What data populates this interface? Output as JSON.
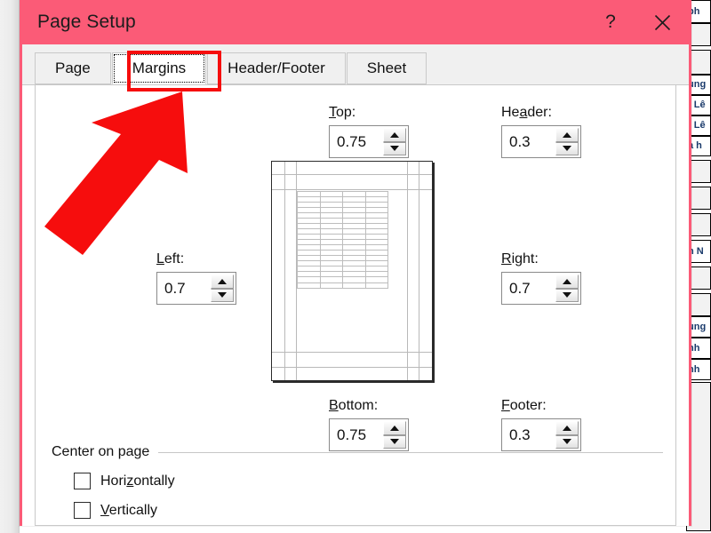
{
  "window": {
    "title": "Page Setup",
    "help_icon": "question-mark-icon",
    "close_icon": "close-icon",
    "titlebar_color": "#fb5b77"
  },
  "tabs": [
    {
      "label": "Page",
      "active": false
    },
    {
      "label": "Margins",
      "active": true
    },
    {
      "label": "Header/Footer",
      "active": false
    },
    {
      "label": "Sheet",
      "active": false
    }
  ],
  "margins": {
    "top": {
      "label": "Top:",
      "accel": "T",
      "value": "0.75"
    },
    "header": {
      "label": "Header:",
      "accel": "a",
      "value": "0.3"
    },
    "left": {
      "label": "Left:",
      "accel": "L",
      "value": "0.7"
    },
    "right": {
      "label": "Right:",
      "accel": "R",
      "value": "0.7"
    },
    "bottom": {
      "label": "Bottom:",
      "accel": "B",
      "value": "0.75"
    },
    "footer": {
      "label": "Footer:",
      "accel": "F",
      "value": "0.3"
    },
    "spinner_up_icon": "triangle-up-icon",
    "spinner_down_icon": "triangle-down-icon"
  },
  "preview": {
    "name": "page-preview",
    "description": "Page layout preview with margin guides and data table grid"
  },
  "center_on_page": {
    "group_label": "Center on page",
    "horizontally": {
      "label": "Horizontally",
      "accel": "z",
      "checked": false
    },
    "vertically": {
      "label": "Vertically",
      "accel": "V",
      "checked": false
    }
  },
  "annotations": {
    "highlight_color": "#f60d0d",
    "highlight_target": "Margins",
    "arrow": "red-arrow-pointing-to-margins-tab"
  },
  "background_sheet": {
    "cells": [
      {
        "text": "ph",
        "kind": "hdr"
      },
      {
        "text": "",
        "kind": "empty"
      },
      {
        "text": "",
        "kind": "empty"
      },
      {
        "text": "ùng",
        "kind": "text"
      },
      {
        "text": ": Lê",
        "kind": "text"
      },
      {
        "text": ": Lê",
        "kind": "text"
      },
      {
        "text": "a h",
        "kind": "text"
      },
      {
        "text": "",
        "kind": "empty"
      },
      {
        "text": "",
        "kind": "empty"
      },
      {
        "text": "",
        "kind": "empty"
      },
      {
        "text": "n N",
        "kind": "text"
      },
      {
        "text": "",
        "kind": "empty"
      },
      {
        "text": "",
        "kind": "empty"
      },
      {
        "text": "ùng",
        "kind": "text"
      },
      {
        "text": "nh",
        "kind": "text"
      },
      {
        "text": "nh",
        "kind": "text"
      }
    ]
  }
}
